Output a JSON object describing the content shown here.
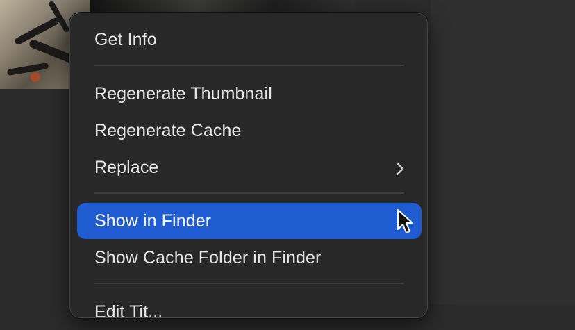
{
  "context_menu": {
    "items": [
      {
        "label": "Get Info"
      },
      {
        "label": "Regenerate Thumbnail"
      },
      {
        "label": "Regenerate Cache"
      },
      {
        "label": "Replace",
        "has_submenu": true,
        "icon": "chevron-right-icon"
      },
      {
        "label": "Show in Finder",
        "highlighted": true
      },
      {
        "label": "Show Cache Folder in Finder"
      },
      {
        "label": "Edit Tit..."
      }
    ]
  },
  "colors": {
    "menu_background": "#282828",
    "highlight": "#1f5bd1",
    "text": "#e6e6e6",
    "separator": "#3e3e3e"
  }
}
